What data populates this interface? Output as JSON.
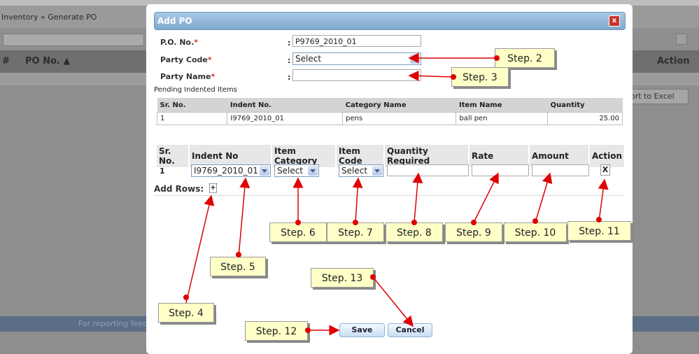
{
  "background": {
    "breadcrumb": "Inventory » Generate PO",
    "col_hash": "#",
    "col_po_no": "PO No. ▲",
    "col_action": "Action",
    "export_label": "ort to Excel",
    "footer_text": "For reporting feedb"
  },
  "modal": {
    "title": "Add PO",
    "close": "x",
    "po_no_label": "P.O. No.",
    "po_no_value": "P9769_2010_01",
    "party_code_label": "Party Code",
    "party_code_value": "Select",
    "party_name_label": "Party Name",
    "party_name_value": "",
    "required_mark": "*",
    "colon": ":",
    "pending_title": "Pending Indented Items",
    "pending_headers": [
      "Sr. No.",
      "Indent No.",
      "Category Name",
      "Item Name",
      "Quantity"
    ],
    "pending_rows": [
      [
        "1",
        "I9769_2010_01",
        "pens",
        "ball pen",
        "25.00"
      ]
    ],
    "grid_headers": [
      "Sr. No.",
      "Indent No",
      "Item Category",
      "Item Code",
      "Quantity Required",
      "Rate",
      "Amount",
      "Action"
    ],
    "grid_row": {
      "sr": "1",
      "indent": "I9769_2010_01",
      "category": "Select",
      "item_code": "Select",
      "action": "X"
    },
    "add_rows_label": "Add Rows:",
    "add_rows_btn": "+",
    "save": "Save",
    "cancel": "Cancel"
  },
  "steps": [
    "Step. 2",
    "Step. 3",
    "Step. 4",
    "Step. 5",
    "Step. 6",
    "Step. 7",
    "Step. 8",
    "Step. 9",
    "Step. 10",
    "Step. 11",
    "Step. 12",
    "Step. 13"
  ],
  "colors": {
    "arrow": "#e00000",
    "callout": "#ffffc8",
    "title_bar": "#8fb6d8"
  }
}
